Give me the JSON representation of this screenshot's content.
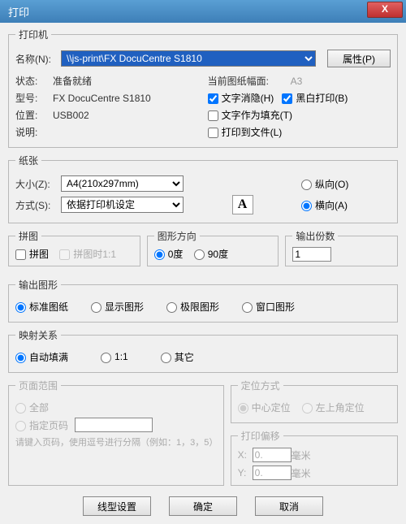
{
  "window": {
    "title": "打印",
    "close": "X"
  },
  "printer": {
    "legend": "打印机",
    "name_lbl": "名称(N):",
    "name_val": "\\\\js-print\\FX DocuCentre S1810",
    "props_btn": "属性(P)",
    "status_lbl": "状态:",
    "status_val": "准备就绪",
    "type_lbl": "型号:",
    "type_val": "FX DocuCentre S1810",
    "where_lbl": "位置:",
    "where_val": "USB002",
    "comment_lbl": "说明:",
    "paperside_lbl": "当前图纸幅面:",
    "paperside_val": "A3",
    "ck_hidetext": "文字消隐(H)",
    "ck_bw": "黑白打印(B)",
    "ck_textfill": "文字作为填充(T)",
    "ck_tofile": "打印到文件(L)"
  },
  "paper": {
    "legend": "纸张",
    "size_lbl": "大小(Z):",
    "size_val": "A4(210x297mm)",
    "mode_lbl": "方式(S):",
    "mode_val": "依据打印机设定",
    "portrait": "纵向(O)",
    "landscape": "横向(A)"
  },
  "tile": {
    "legend": "拼图",
    "ck": "拼图",
    "ck2": "拼图时1:1"
  },
  "dir": {
    "legend": "图形方向",
    "d0": "0度",
    "d90": "90度"
  },
  "copies": {
    "legend": "输出份数",
    "val": "1"
  },
  "outshape": {
    "legend": "输出图形",
    "o1": "标准图纸",
    "o2": "显示图形",
    "o3": "极限图形",
    "o4": "窗口图形"
  },
  "mapping": {
    "legend": "映射关系",
    "m1": "自动填满",
    "m2": "1:1",
    "m3": "其它"
  },
  "range": {
    "legend": "页面范围",
    "all": "全部",
    "pages": "指定页码",
    "hint": "请键入页码，使用逗号进行分隔（例如：1，3，5）"
  },
  "locate": {
    "legend": "定位方式",
    "center": "中心定位",
    "topleft": "左上角定位"
  },
  "offset": {
    "legend": "打印偏移",
    "x": "X:",
    "y": "Y:",
    "xv": "0.",
    "yv": "0.",
    "unit": "毫米"
  },
  "footer": {
    "line": "线型设置",
    "ok": "确定",
    "cancel": "取消"
  }
}
